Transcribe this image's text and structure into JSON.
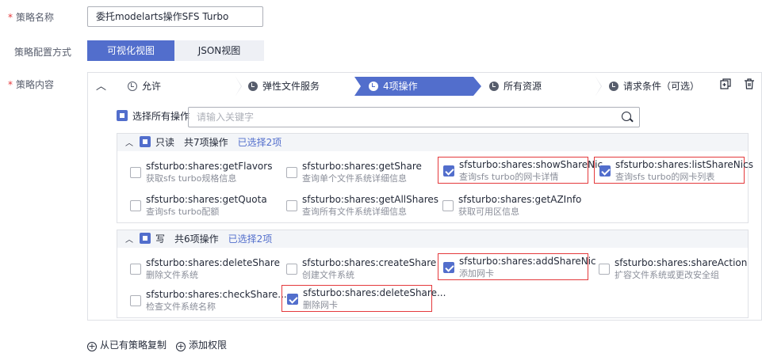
{
  "form": {
    "name_label": "策略名称",
    "name_value": "委托modelarts操作SFS Turbo",
    "mode_label": "策略配置方式",
    "mode_visual": "可视化视图",
    "mode_json": "JSON视图",
    "content_label": "策略内容"
  },
  "steps": [
    {
      "label": "允许"
    },
    {
      "label": "弹性文件服务"
    },
    {
      "label": "4项操作"
    },
    {
      "label": "所有资源"
    },
    {
      "label": "请求条件（可选）"
    }
  ],
  "select_all_label": "选择所有操作",
  "search_placeholder": "请输入关键字",
  "groups": [
    {
      "name": "只读",
      "count": "共7项操作",
      "selected": "已选择2项",
      "actions": [
        {
          "name": "sfsturbo:shares:getFlavors",
          "desc": "获取sfs turbo规格信息",
          "checked": false
        },
        {
          "name": "sfsturbo:shares:getShare",
          "desc": "查询单个文件系统详细信息",
          "checked": false
        },
        {
          "name": "sfsturbo:shares:showShareNic",
          "desc": "查询sfs turbo的网卡详情",
          "checked": true
        },
        {
          "name": "sfsturbo:shares:listShareNics",
          "desc": "查询sfs turbo的网卡列表",
          "checked": true
        },
        {
          "name": "sfsturbo:shares:getQuota",
          "desc": "查询sfs turbo配额",
          "checked": false
        },
        {
          "name": "sfsturbo:shares:getAllShares",
          "desc": "查询所有文件系统详细信息",
          "checked": false
        },
        {
          "name": "sfsturbo:shares:getAZInfo",
          "desc": "获取可用区信息",
          "checked": false
        }
      ]
    },
    {
      "name": "写",
      "count": "共6项操作",
      "selected": "已选择2项",
      "actions": [
        {
          "name": "sfsturbo:shares:deleteShare",
          "desc": "删除文件系统",
          "checked": false
        },
        {
          "name": "sfsturbo:shares:createShare",
          "desc": "创建文件系统",
          "checked": false
        },
        {
          "name": "sfsturbo:shares:addShareNic",
          "desc": "添加网卡",
          "checked": true
        },
        {
          "name": "sfsturbo:shares:shareAction",
          "desc": "扩容文件系统或更改安全组",
          "checked": false
        },
        {
          "name": "sfsturbo:shares:checkShare...",
          "desc": "检查文件系统名称",
          "checked": false
        },
        {
          "name": "sfsturbo:shares:deleteShare...",
          "desc": "删除网卡",
          "checked": true
        }
      ]
    }
  ],
  "footer": {
    "copy_label": "从已有策略复制",
    "add_label": "添加权限"
  },
  "icons": {
    "collapse": "chevron-up-icon",
    "copy": "copy-icon",
    "delete": "trash-icon",
    "search": "search-icon"
  },
  "colors": {
    "accent": "#526ecc",
    "required": "#e4393c",
    "highlight": "#e4393c"
  }
}
